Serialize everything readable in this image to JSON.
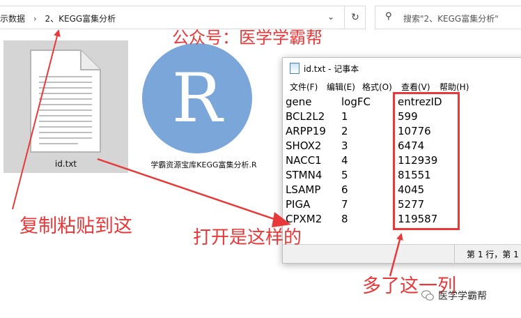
{
  "explorer": {
    "breadcrumb_parent": "示数据",
    "breadcrumb_current": "2、KEGG富集分析",
    "search_placeholder": "搜索\"2、KEGG富集分析\"",
    "files": [
      {
        "name": "id.txt",
        "icon": "text-file-icon"
      },
      {
        "name": "学霸资源宝库KEGG富集分析.R",
        "icon": "r-script-icon",
        "glyph": "R"
      }
    ]
  },
  "notepad": {
    "title": "id.txt - 记事本",
    "menu": [
      "文件(F)",
      "编辑(E)",
      "格式(O)",
      "查看(V)",
      "帮助(H)"
    ],
    "columns": [
      "gene",
      "logFC",
      "entrezID"
    ],
    "rows": [
      [
        "BCL2L2",
        "1",
        "599"
      ],
      [
        "ARPP19",
        "2",
        "10776"
      ],
      [
        "SHOX2",
        "3",
        "6474"
      ],
      [
        "NACC1",
        "4",
        "112939"
      ],
      [
        "STMN4",
        "5",
        "81551"
      ],
      [
        "LSAMP",
        "6",
        "4045"
      ],
      [
        "PIGA",
        "7",
        "5277"
      ],
      [
        "CPXM2",
        "8",
        "119587"
      ]
    ],
    "status": "第 1 行，第 1"
  },
  "annotations": {
    "top": "公众号：医学学霸帮",
    "copy": "复制粘贴到这",
    "open": "打开是这样的",
    "extra_column": "多了这一列"
  },
  "watermark": "医学学霸帮",
  "colors": {
    "annotation": "#e8393a",
    "r_icon": "#7aa6d9",
    "selection": "#d5d5d5"
  }
}
